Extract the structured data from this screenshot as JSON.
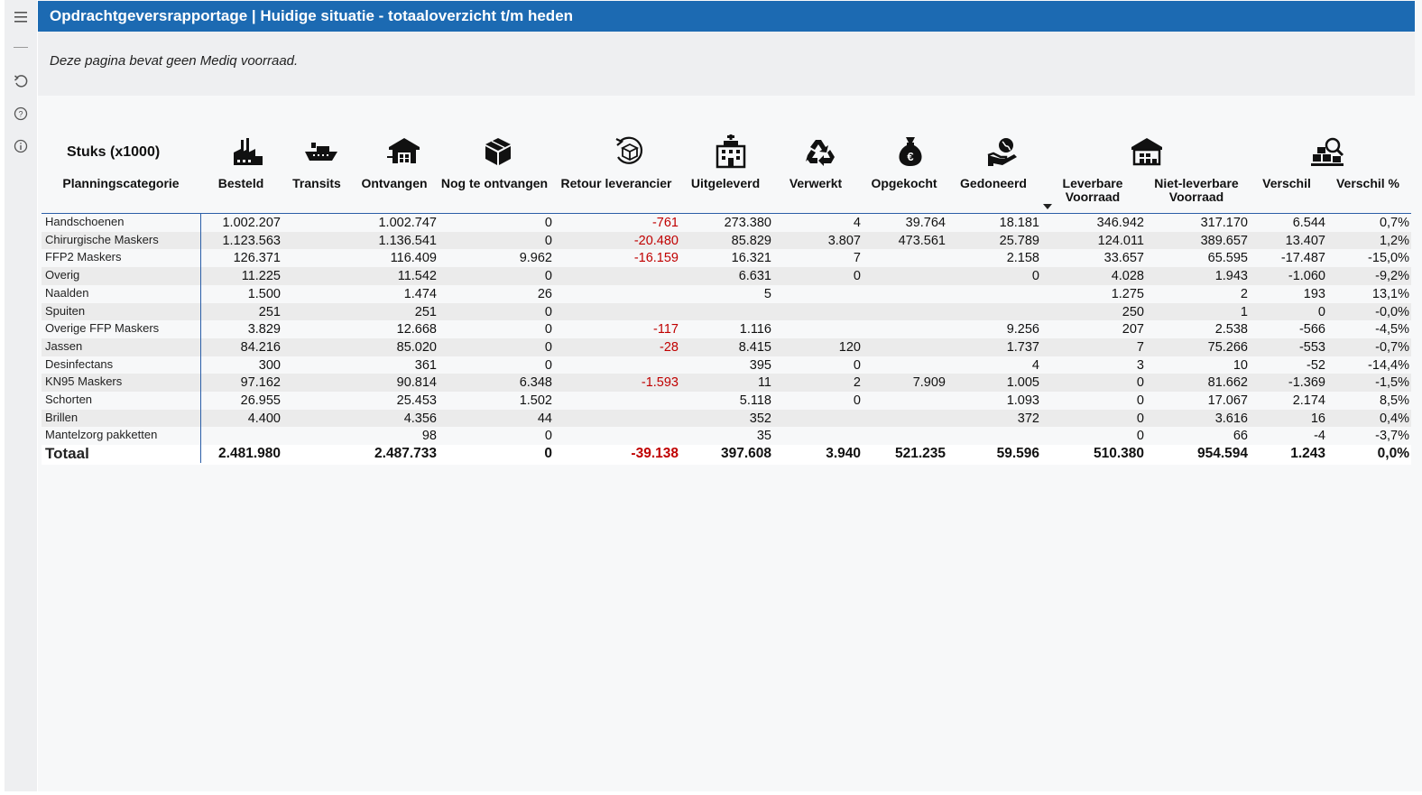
{
  "header": {
    "title": "Opdrachtgeversrapportage | Huidige situatie - totaaloverzicht t/m heden"
  },
  "notice": "Deze pagina bevat geen Mediq voorraad.",
  "table": {
    "units_label": "Stuks (x1000)",
    "category_header": "Planningscategorie",
    "columns": [
      {
        "label": "Besteld",
        "icon": "factory-icon"
      },
      {
        "label": "Transits",
        "icon": "ship-icon"
      },
      {
        "label": "Ontvangen",
        "icon": "warehouse-inflow-icon"
      },
      {
        "label": "Nog te ontvangen",
        "icon": "box-icon"
      },
      {
        "label": "Retour leverancier",
        "icon": "return-box-icon"
      },
      {
        "label": "Uitgeleverd",
        "icon": "hospital-icon"
      },
      {
        "label": "Verwerkt",
        "icon": "recycle-icon"
      },
      {
        "label": "Opgekocht",
        "icon": "money-bag-icon"
      },
      {
        "label": "Gedoneerd",
        "icon": "donate-hand-icon"
      },
      {
        "label": "Leverbare Voorraad",
        "label_line1": "Leverbare",
        "label_line2": "Voorraad",
        "icon": "warehouse-icon"
      },
      {
        "label": "Niet-leverbare Voorraad",
        "label_line1": "Niet-leverbare",
        "label_line2": "Voorraad",
        "icon": ""
      },
      {
        "label": "Verschil",
        "icon": "inspect-boxes-icon"
      },
      {
        "label": "Verschil %",
        "icon": ""
      }
    ],
    "rows": [
      {
        "category": "Handschoenen",
        "values": [
          "1.002.207",
          "",
          "1.002.747",
          "0",
          "-761",
          "273.380",
          "4",
          "39.764",
          "18.181",
          "346.942",
          "317.170",
          "6.544",
          "0,7%"
        ]
      },
      {
        "category": "Chirurgische Maskers",
        "values": [
          "1.123.563",
          "",
          "1.136.541",
          "0",
          "-20.480",
          "85.829",
          "3.807",
          "473.561",
          "25.789",
          "124.011",
          "389.657",
          "13.407",
          "1,2%"
        ]
      },
      {
        "category": "FFP2 Maskers",
        "values": [
          "126.371",
          "",
          "116.409",
          "9.962",
          "-16.159",
          "16.321",
          "7",
          "",
          "2.158",
          "33.657",
          "65.595",
          "-17.487",
          "-15,0%"
        ]
      },
      {
        "category": "Overig",
        "values": [
          "11.225",
          "",
          "11.542",
          "0",
          "",
          "6.631",
          "0",
          "",
          "0",
          "4.028",
          "1.943",
          "-1.060",
          "-9,2%"
        ]
      },
      {
        "category": "Naalden",
        "values": [
          "1.500",
          "",
          "1.474",
          "26",
          "",
          "5",
          "",
          "",
          "",
          "1.275",
          "2",
          "193",
          "13,1%"
        ]
      },
      {
        "category": "Spuiten",
        "values": [
          "251",
          "",
          "251",
          "0",
          "",
          "",
          "",
          "",
          "",
          "250",
          "1",
          "0",
          "-0,0%"
        ]
      },
      {
        "category": "Overige FFP Maskers",
        "values": [
          "3.829",
          "",
          "12.668",
          "0",
          "-117",
          "1.116",
          "",
          "",
          "9.256",
          "207",
          "2.538",
          "-566",
          "-4,5%"
        ]
      },
      {
        "category": "Jassen",
        "values": [
          "84.216",
          "",
          "85.020",
          "0",
          "-28",
          "8.415",
          "120",
          "",
          "1.737",
          "7",
          "75.266",
          "-553",
          "-0,7%"
        ]
      },
      {
        "category": "Desinfectans",
        "values": [
          "300",
          "",
          "361",
          "0",
          "",
          "395",
          "0",
          "",
          "4",
          "3",
          "10",
          "-52",
          "-14,4%"
        ]
      },
      {
        "category": "KN95 Maskers",
        "values": [
          "97.162",
          "",
          "90.814",
          "6.348",
          "-1.593",
          "11",
          "2",
          "7.909",
          "1.005",
          "0",
          "81.662",
          "-1.369",
          "-1,5%"
        ]
      },
      {
        "category": "Schorten",
        "values": [
          "26.955",
          "",
          "25.453",
          "1.502",
          "",
          "5.118",
          "0",
          "",
          "1.093",
          "0",
          "17.067",
          "2.174",
          "8,5%"
        ]
      },
      {
        "category": "Brillen",
        "values": [
          "4.400",
          "",
          "4.356",
          "44",
          "",
          "352",
          "",
          "",
          "372",
          "0",
          "3.616",
          "16",
          "0,4%"
        ]
      },
      {
        "category": "Mantelzorg pakketten",
        "values": [
          "",
          "",
          "98",
          "0",
          "",
          "35",
          "",
          "",
          "",
          "0",
          "66",
          "-4",
          "-3,7%"
        ]
      }
    ],
    "total": {
      "category": "Totaal",
      "values": [
        "2.481.980",
        "",
        "2.487.733",
        "0",
        "-39.138",
        "397.608",
        "3.940",
        "521.235",
        "59.596",
        "510.380",
        "954.594",
        "1.243",
        "0,0%"
      ]
    }
  },
  "colors": {
    "header_bg": "#1c6ab2",
    "negative": "#c00000",
    "rule": "#2b5ea7"
  }
}
